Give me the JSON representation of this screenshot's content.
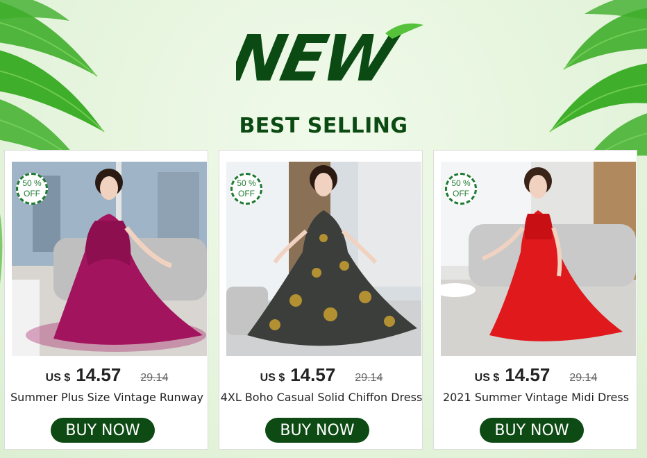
{
  "banner": {
    "headline": "NEW",
    "subheadline": "BEST SELLING"
  },
  "colors": {
    "brand_green": "#0d4a14",
    "badge_green": "#1f7a32",
    "background": "#e8f5e1"
  },
  "products": [
    {
      "badge_percent": "50 %",
      "badge_off": "OFF",
      "currency": "US $",
      "price": "14.57",
      "old_price": "29.14",
      "title": "Summer Plus Size Vintage Runway",
      "button": "BUY NOW",
      "dress_color": "#a3145e"
    },
    {
      "badge_percent": "50 %",
      "badge_off": "OFF",
      "currency": "US $",
      "price": "14.57",
      "old_price": "29.14",
      "title": "4XL Boho Casual Solid Chiffon Dress",
      "button": "BUY NOW",
      "dress_color": "#3b3e3a"
    },
    {
      "badge_percent": "50 %",
      "badge_off": "OFF",
      "currency": "US $",
      "price": "14.57",
      "old_price": "29.14",
      "title": "2021 Summer Vintage Midi Dress",
      "button": "BUY NOW",
      "dress_color": "#e0191c"
    }
  ]
}
